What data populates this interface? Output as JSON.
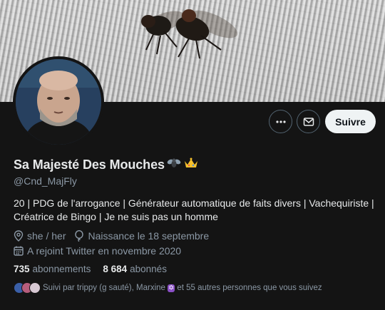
{
  "profile": {
    "display_name": "Sa Majesté Des Mouches",
    "name_emojis": [
      "fly-emoji",
      "crown-emoji"
    ],
    "handle": "@Cnd_MajFly",
    "bio_line1": "20 | PDG de l'arrogance | Générateur automatique de faits divers | Vachequiriste |",
    "bio_line2": "Créatrice de Bingo | Je ne suis pas un homme",
    "pronouns": "she / her",
    "birthday": "Naissance le 18 septembre",
    "joined": "A rejoint Twitter en novembre 2020"
  },
  "actions": {
    "more_icon": "more-horizontal-icon",
    "message_icon": "mail-icon",
    "follow_label": "Suivre"
  },
  "stats": {
    "following_count": "735",
    "following_label": "abonnements",
    "followers_count": "8 684",
    "followers_label": "abonnés"
  },
  "followed_by": {
    "prefix": "Suivi par trippy (g sauté), Marxine",
    "suffix": "et 55 autres personnes que vous suivez"
  },
  "colors": {
    "background": "#141414",
    "text_primary": "#e7e9ea",
    "text_secondary": "#8b98a5",
    "follow_button_bg": "#eff3f4",
    "border": "#536471"
  }
}
